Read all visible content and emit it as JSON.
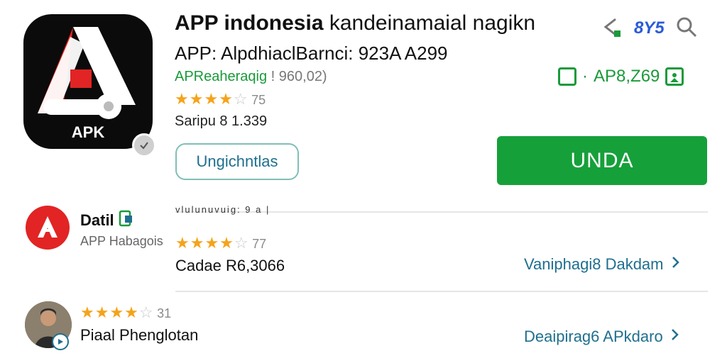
{
  "app": {
    "icon_label": "APK",
    "title_bold": "APP indonesia",
    "title_rest": " kandeinamaial nagikn",
    "subtitle": "APP: AlpdhiaclBarnci: 923A A299",
    "developer": "APReaheraqig",
    "developer_meta": " ! 960,02)",
    "rating_stars": 3.5,
    "rating_count": "75",
    "size_text": "Saripu 8 1.339",
    "secondary_button": "Ungichntlas",
    "install_button": "UNDA"
  },
  "header_actions": {
    "share_icon": "share-icon",
    "count": "8Y5",
    "search_icon": "search-icon"
  },
  "price": {
    "value": "AP8,Z69",
    "separator": "·"
  },
  "section_caption": "vlulunuvuig: 9 a |",
  "related": [
    {
      "name": "Datil",
      "subtitle": "APP Habagois",
      "rating_stars": 4.5,
      "rating_count": "77",
      "detail": "Cadae R6,3066",
      "link": "Vaniphagi8 Dakdam"
    },
    {
      "name": "Piaal Phenglotan",
      "rating_stars": 4,
      "rating_count": "31",
      "link": "Deaipirag6 APkdaro"
    }
  ],
  "colors": {
    "accent_green": "#16a03a",
    "text_green": "#1a9a3a",
    "star": "#f5a31a",
    "link_teal": "#1f6f8f",
    "icon_red": "#e22424"
  }
}
